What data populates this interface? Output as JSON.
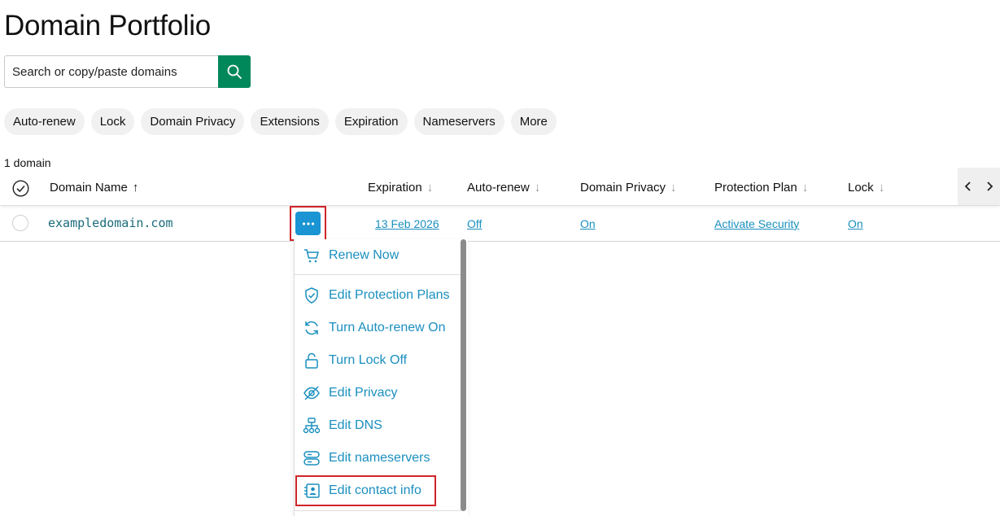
{
  "page": {
    "title": "Domain Portfolio"
  },
  "search": {
    "placeholder": "Search or copy/paste domains",
    "button_icon": "search-icon",
    "accent": "#00875a"
  },
  "filters": [
    "Auto-renew",
    "Lock",
    "Domain Privacy",
    "Extensions",
    "Expiration",
    "Nameservers",
    "More"
  ],
  "summary": {
    "count_label": "1 domain"
  },
  "table": {
    "columns": [
      "Domain Name",
      "Expiration",
      "Auto-renew",
      "Domain Privacy",
      "Protection Plan",
      "Lock"
    ],
    "sorted_column": "Domain Name",
    "rows": [
      {
        "domain": "exampledomain.com",
        "expiration": "13 Feb 2026",
        "auto_renew": "Off",
        "privacy": "On",
        "protection": "Activate Security",
        "lock": "On"
      }
    ]
  },
  "menu": {
    "items": [
      {
        "label": "Renew Now",
        "icon": "cart-icon"
      },
      {
        "label": "Edit Protection Plans",
        "icon": "shield-check-icon"
      },
      {
        "label": "Turn Auto-renew On",
        "icon": "refresh-icon"
      },
      {
        "label": "Turn Lock Off",
        "icon": "unlock-icon"
      },
      {
        "label": "Edit Privacy",
        "icon": "eye-off-icon"
      },
      {
        "label": "Edit DNS",
        "icon": "dns-tree-icon"
      },
      {
        "label": "Edit nameservers",
        "icon": "server-icon"
      },
      {
        "label": "Edit contact info",
        "icon": "contact-card-icon"
      }
    ]
  },
  "colors": {
    "link": "#1a8fbf",
    "highlight": "#d0242b",
    "more_button": "#1a94d2",
    "domain_text": "#1a6b7a"
  }
}
